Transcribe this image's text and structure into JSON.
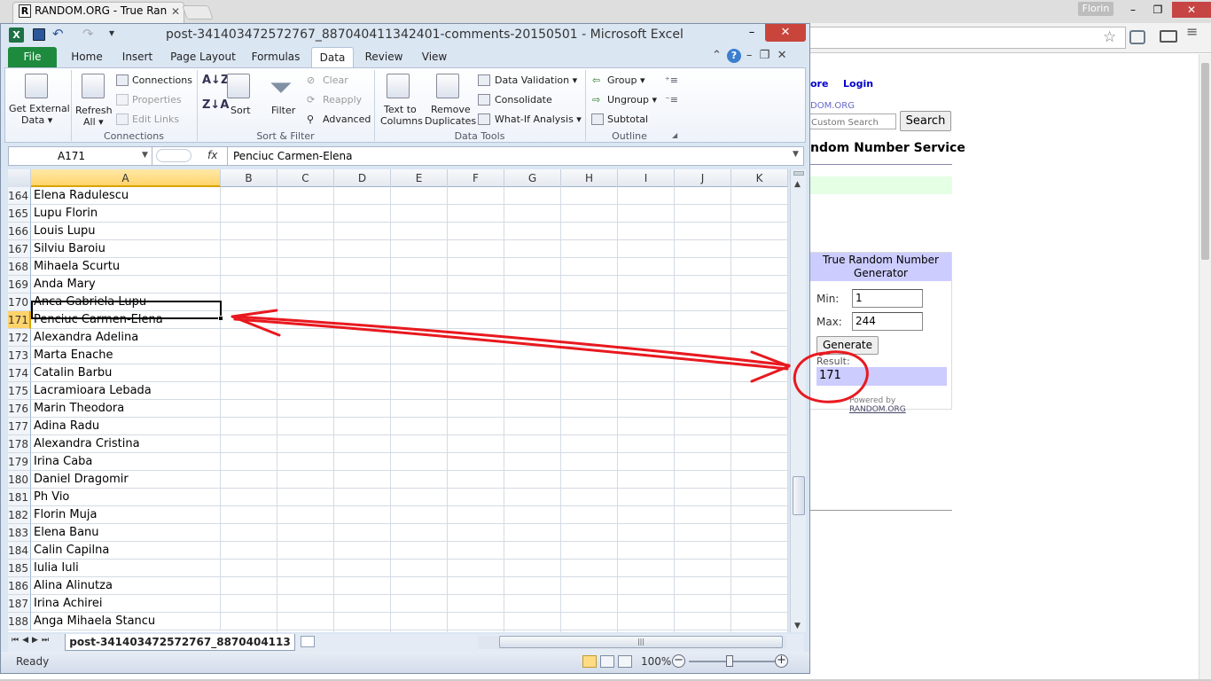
{
  "browser": {
    "tab_title": "RANDOM.ORG - True Ran",
    "tab_favicon": "R",
    "user_name": "Florin",
    "min_glyph": "–",
    "max_glyph": "❐",
    "close_glyph": "✕",
    "star_glyph": "☆",
    "menu_glyph": "≡"
  },
  "webpage": {
    "nav_more": "ore",
    "nav_login": "Login",
    "random_link": "DOM.ORG",
    "search_placeholder": "Custom Search",
    "search_button": "Search",
    "service_title": "ndom Number Service",
    "widget": {
      "title_line1": "True Random Number",
      "title_line2": "Generator",
      "min_label": "Min:",
      "min_value": "1",
      "max_label": "Max:",
      "max_value": "244",
      "generate_button": "Generate",
      "result_label": "Result:",
      "result_value": "171",
      "powered_by": "Powered by",
      "powered_link": "RANDOM.ORG"
    }
  },
  "excel": {
    "title": "post-341403472572767_887040411342401-comments-20150501  -  Microsoft Excel",
    "logo": "X",
    "min_glyph": "–",
    "max_glyph": "□",
    "close_glyph": "✕",
    "tabs": {
      "file": "File",
      "home": "Home",
      "insert": "Insert",
      "page_layout": "Page Layout",
      "formulas": "Formulas",
      "data": "Data",
      "review": "Review",
      "view": "View"
    },
    "ribbon": {
      "get_external_1": "Get External",
      "get_external_2": "Data ▾",
      "refresh_1": "Refresh",
      "refresh_2": "All ▾",
      "connections": "Connections",
      "properties": "Properties",
      "edit_links": "Edit Links",
      "group_connections": "Connections",
      "sort": "Sort",
      "filter": "Filter",
      "clear": "Clear",
      "reapply": "Reapply",
      "advanced": "Advanced",
      "group_sort_filter": "Sort & Filter",
      "text_to_1": "Text to",
      "text_to_2": "Columns",
      "remove_1": "Remove",
      "remove_2": "Duplicates",
      "data_validation": "Data Validation ▾",
      "consolidate": "Consolidate",
      "what_if": "What-If Analysis ▾",
      "group_data_tools": "Data Tools",
      "group": "Group ▾",
      "ungroup": "Ungroup ▾",
      "subtotal": "Subtotal",
      "group_outline": "Outline"
    },
    "namebox": "A171",
    "fx": "fx",
    "formula": "Penciuc Carmen-Elena",
    "columns": [
      "A",
      "B",
      "C",
      "D",
      "E",
      "F",
      "G",
      "H",
      "I",
      "J",
      "K"
    ],
    "rows": [
      {
        "num": "164",
        "value": "Elena Radulescu"
      },
      {
        "num": "165",
        "value": "Lupu Florin"
      },
      {
        "num": "166",
        "value": "Louis Lupu"
      },
      {
        "num": "167",
        "value": "Silviu Baroiu"
      },
      {
        "num": "168",
        "value": "Mihaela Scurtu"
      },
      {
        "num": "169",
        "value": "Anda Mary"
      },
      {
        "num": "170",
        "value": "Anca Gabriela Lupu"
      },
      {
        "num": "171",
        "value": "Penciuc Carmen-Elena"
      },
      {
        "num": "172",
        "value": "Alexandra Adelina"
      },
      {
        "num": "173",
        "value": "Marta Enache"
      },
      {
        "num": "174",
        "value": "Catalin Barbu"
      },
      {
        "num": "175",
        "value": "Lacramioara Lebada"
      },
      {
        "num": "176",
        "value": "Marin Theodora"
      },
      {
        "num": "177",
        "value": "Adina Radu"
      },
      {
        "num": "178",
        "value": "Alexandra Cristina"
      },
      {
        "num": "179",
        "value": "Irina Caba"
      },
      {
        "num": "180",
        "value": "Daniel Dragomir"
      },
      {
        "num": "181",
        "value": "Ph Vio"
      },
      {
        "num": "182",
        "value": "Florin Muja"
      },
      {
        "num": "183",
        "value": "Elena Banu"
      },
      {
        "num": "184",
        "value": "Calin Capilna"
      },
      {
        "num": "185",
        "value": "Iulia Iuli"
      },
      {
        "num": "186",
        "value": "Alina Alinutza"
      },
      {
        "num": "187",
        "value": "Irina Achirei"
      },
      {
        "num": "188",
        "value": "Anga Mihaela Stancu"
      }
    ],
    "selected_row": "171",
    "sheet_nav": "⏮◀▶⏭",
    "sheet_tab": "post-341403472572767_8870404113",
    "status": "Ready",
    "zoom": "100%",
    "zoom_minus": "−",
    "zoom_plus": "+"
  },
  "colors": {
    "annotation": "#e8191f",
    "excel_green": "#1e8a3d",
    "widget_bg": "#ccccff"
  }
}
